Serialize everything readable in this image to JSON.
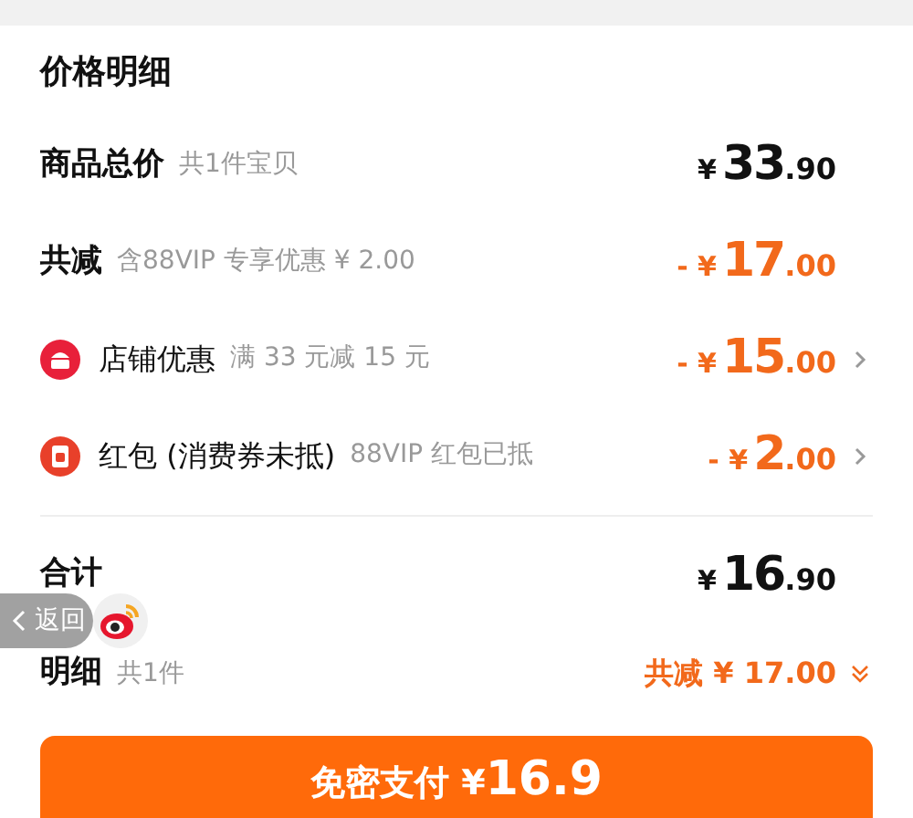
{
  "title": "价格明细",
  "rows": [
    {
      "kind": "plain",
      "label": "商品总价",
      "note": "共1件宝贝",
      "discount": false,
      "price": {
        "currency": "¥",
        "integer": "33",
        "fraction": ".90"
      }
    },
    {
      "kind": "plain",
      "label": "共减",
      "note": "含88VIP 专享优惠 ¥ 2.00",
      "discount": true,
      "price": {
        "sign": "-",
        "currency": "¥",
        "integer": "17",
        "fraction": ".00"
      }
    },
    {
      "kind": "shop",
      "label": "店铺优惠",
      "note": "满 33 元减 15 元",
      "discount": true,
      "price": {
        "sign": "-",
        "currency": "¥",
        "integer": "15",
        "fraction": ".00"
      }
    },
    {
      "kind": "redpacket",
      "label": "红包 (消费券未抵)",
      "note": "88VIP 红包已抵",
      "discount": true,
      "price": {
        "sign": "-",
        "currency": "¥",
        "integer": "2",
        "fraction": ".00"
      }
    }
  ],
  "total": {
    "label": "合计",
    "price": {
      "currency": "¥",
      "integer": "16",
      "fraction": ".90"
    }
  },
  "detail": {
    "label": "明细",
    "note": "共1件",
    "saving": "共减 ¥ 17.00",
    "expanded": false
  },
  "pay_button": {
    "label": "免密支付",
    "currency": "¥",
    "amount": "16.9"
  },
  "back_overlay": {
    "label": "返回"
  }
}
